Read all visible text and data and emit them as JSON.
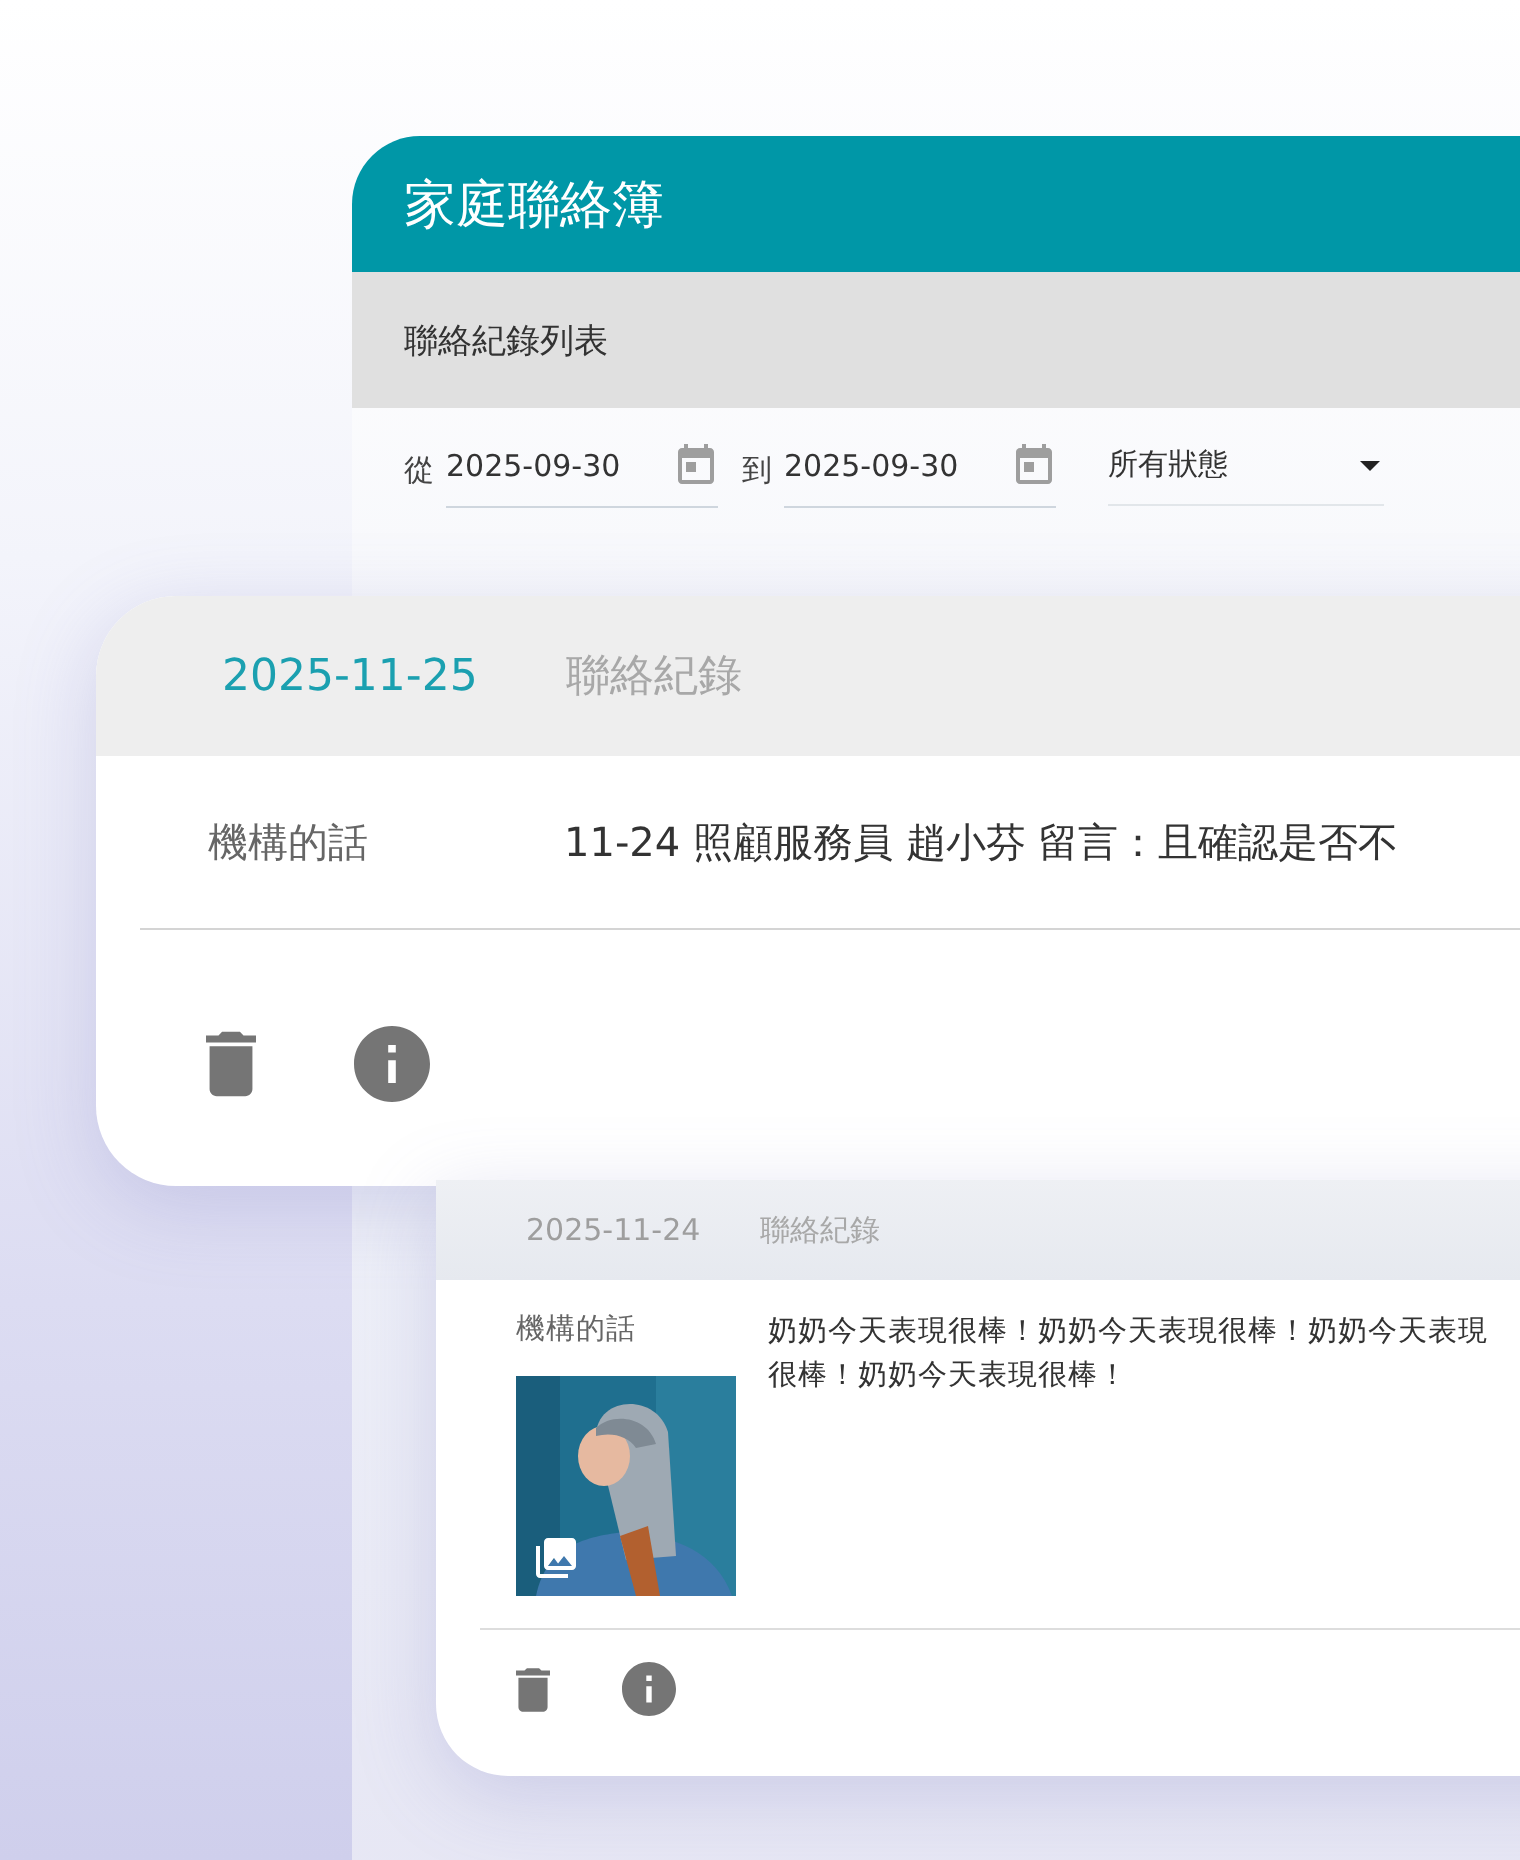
{
  "app_bar": {
    "title": "家庭聯絡簿"
  },
  "subheader": {
    "title": "聯絡紀錄列表"
  },
  "filters": {
    "from_label": "從",
    "from_date": "2025-09-30",
    "to_label": "到",
    "to_date": "2025-09-30",
    "status": "所有狀態"
  },
  "cards": [
    {
      "kind": "large",
      "highlighted": true,
      "date": "2025-11-25",
      "type": "聯絡紀錄",
      "label": "機構的話",
      "message": "11-24 照顧服務員 趙小芬 留言：且確認是否不"
    },
    {
      "kind": "compact",
      "highlighted": false,
      "date": "2025-11-24",
      "type": "聯絡紀錄",
      "label": "機構的話",
      "message": "奶奶今天表現很棒！奶奶今天表現很棒！奶奶今天表現很棒！奶奶今天表現很棒！"
    }
  ]
}
